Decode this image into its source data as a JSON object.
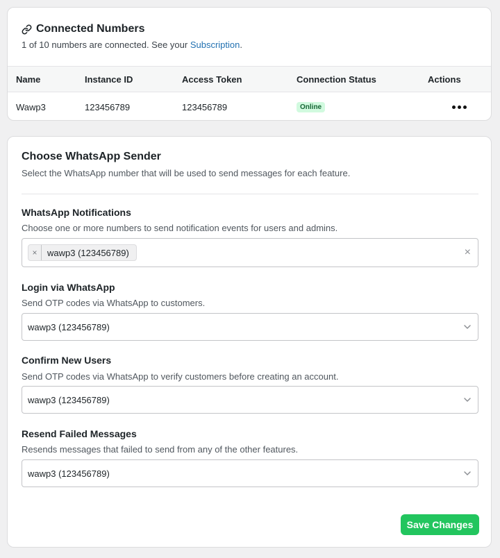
{
  "connected": {
    "title": "Connected Numbers",
    "subtitle_prefix": "1 of 10 numbers are connected. See your ",
    "subscription_link": "Subscription",
    "subtitle_suffix": ".",
    "columns": [
      "Name",
      "Instance ID",
      "Access Token",
      "Connection Status",
      "Actions"
    ],
    "rows": [
      {
        "name": "Wawp3",
        "instance_id": "123456789",
        "access_token": "123456789",
        "status": "Online"
      }
    ]
  },
  "sender": {
    "title": "Choose WhatsApp Sender",
    "subtitle": "Select the WhatsApp number that will be used to send messages for each feature.",
    "notifications": {
      "label": "WhatsApp Notifications",
      "description": "Choose one or more numbers to send notification events for users and admins.",
      "tag_remove": "×",
      "tags": [
        "wawp3 (123456789)"
      ],
      "clear": "×"
    },
    "login": {
      "label": "Login via WhatsApp",
      "description": "Send OTP codes via WhatsApp to customers.",
      "value": "wawp3 (123456789)"
    },
    "confirm": {
      "label": "Confirm New Users",
      "description": "Send OTP codes via WhatsApp to verify customers before creating an account.",
      "value": "wawp3 (123456789)"
    },
    "resend": {
      "label": "Resend Failed Messages",
      "description": "Resends messages that failed to send from any of the other features.",
      "value": "wawp3 (123456789)"
    },
    "save_label": "Save Changes"
  },
  "colors": {
    "accent_green": "#22c55e",
    "online_badge_bg": "#d1fadf",
    "online_badge_text": "#166534",
    "link": "#2271b1"
  },
  "icons": {
    "title": "link-icon",
    "row_actions": "more-horizontal-icon",
    "select": "chevron-down-icon"
  }
}
